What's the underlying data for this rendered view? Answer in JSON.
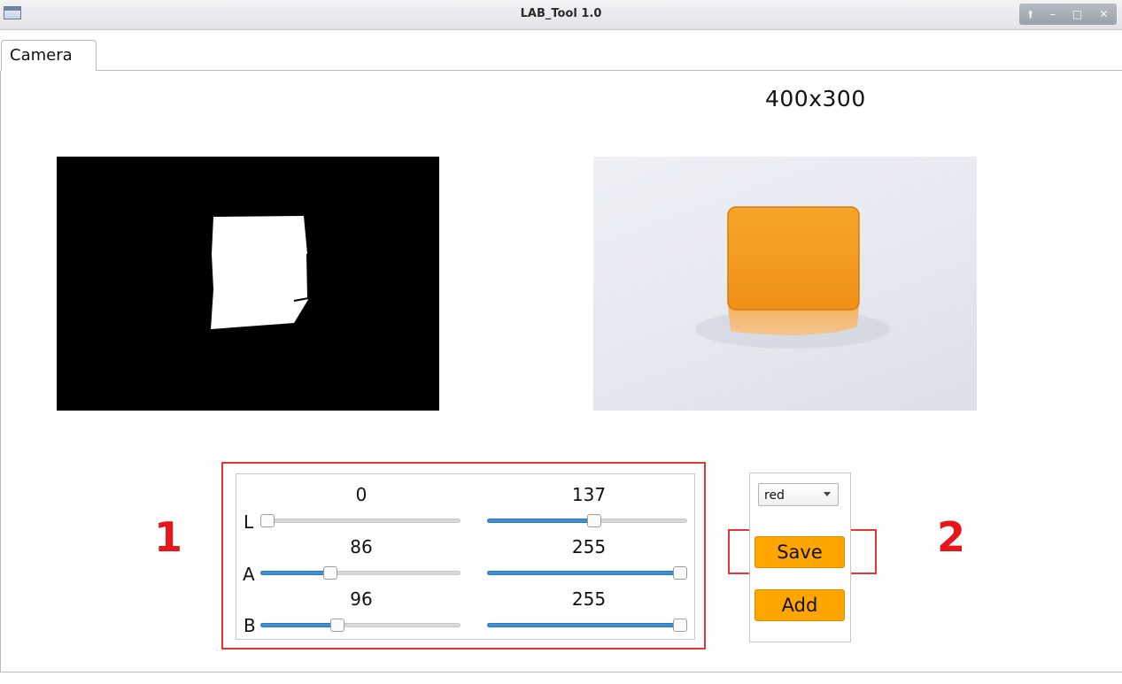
{
  "window": {
    "title": "LAB_Tool 1.0"
  },
  "window_controls": [
    "up-arrow-icon",
    "minimize-icon",
    "maximize-icon",
    "close-icon"
  ],
  "tabs": [
    {
      "label": "Camera",
      "active": true
    }
  ],
  "resolution_label": "400x300",
  "annotations": {
    "slider_group": "1",
    "save_button": "2",
    "color": "#e53535"
  },
  "sliders": {
    "rows": [
      {
        "label": "L",
        "min": {
          "value": "0",
          "fraction": 0.0
        },
        "max": {
          "value": "137",
          "fraction": 0.537
        }
      },
      {
        "label": "A",
        "min": {
          "value": "86",
          "fraction": 0.337
        },
        "max": {
          "value": "255",
          "fraction": 1.0
        }
      },
      {
        "label": "B",
        "min": {
          "value": "96",
          "fraction": 0.376
        },
        "max": {
          "value": "255",
          "fraction": 1.0
        }
      }
    ],
    "range": [
      0,
      255
    ]
  },
  "controls": {
    "color_select": {
      "selected": "red"
    },
    "save_label": "Save",
    "add_label": "Add"
  },
  "colors": {
    "button_accent": "#ffa500",
    "slider_fill": "#3d8fd6",
    "annotation": "#e53535",
    "block_orange": "#f39a1e"
  }
}
